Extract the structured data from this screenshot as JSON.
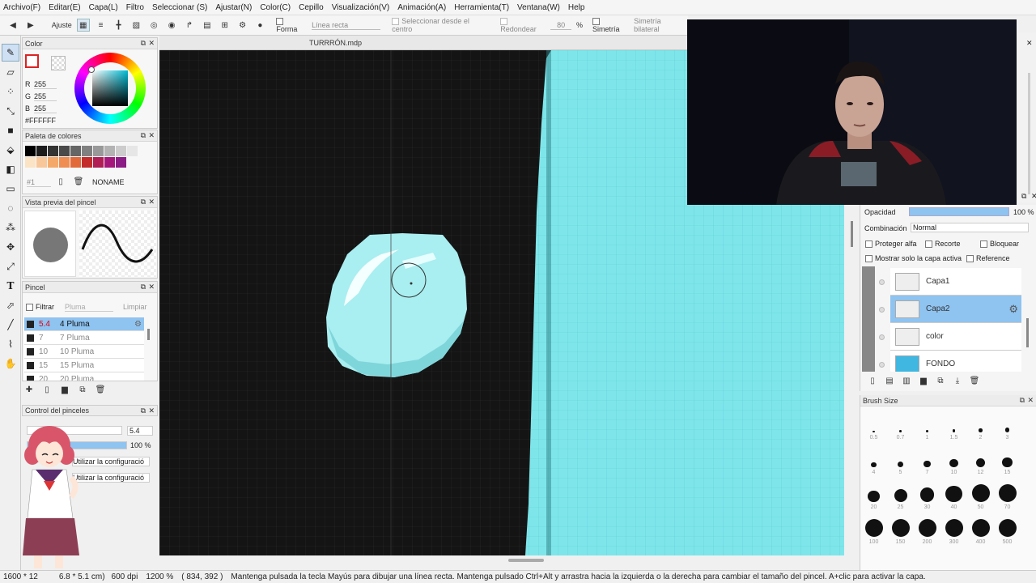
{
  "menu": [
    "Archivo(F)",
    "Editar(E)",
    "Capa(L)",
    "Filtro",
    "Seleccionar (S)",
    "Ajustar(N)",
    "Color(C)",
    "Cepillo",
    "Visualización(V)",
    "Animación(A)",
    "Herramienta(T)",
    "Ventana(W)",
    "Help"
  ],
  "toolbar": {
    "ajuste": "Ajuste",
    "forma_label": "Forma",
    "forma_value": "Línea recta",
    "select_center": "Seleccionar desde el centro",
    "redondear": "Redondear",
    "redondear_value": "80",
    "percent": "%",
    "simetria": "Simetría",
    "simetria_value": "Simetría bilateral"
  },
  "color_panel": {
    "title": "Color",
    "r_label": "R",
    "r": "255",
    "g_label": "G",
    "g": "255",
    "b_label": "B",
    "b": "255",
    "hex": "#FFFFFF",
    "main_color": "#ffffff",
    "sub_color": "#e0e0e0"
  },
  "palette_panel": {
    "title": "Paleta de colores",
    "row1": [
      "#000000",
      "#1c1c1c",
      "#333333",
      "#4a4a4a",
      "#666666",
      "#808080",
      "#999999",
      "#b3b3b3",
      "#cccccc",
      "#e6e6e6"
    ],
    "row2": [
      "#fbe3c5",
      "#f7c79a",
      "#f4a96a",
      "#ef8d52",
      "#e26a3a",
      "#c42b2b",
      "#b01e55",
      "#a6177b",
      "#8c1c86"
    ],
    "slot": "#1",
    "name": "NONAME"
  },
  "preview_panel": {
    "title": "Vista previa del pincel"
  },
  "brush_panel": {
    "title": "Pincel",
    "filter": "Filtrar",
    "filter_placeholder": "Pluma",
    "clear": "Limpiar",
    "items": [
      {
        "size": "5.4",
        "name": "4 Pluma",
        "selected": true
      },
      {
        "size": "7",
        "name": "7 Pluma",
        "selected": false
      },
      {
        "size": "10",
        "name": "10 Pluma",
        "selected": false
      },
      {
        "size": "15",
        "name": "15 Pluma",
        "selected": false
      },
      {
        "size": "20",
        "name": "20 Pluma",
        "selected": false
      }
    ]
  },
  "brush_control": {
    "title": "Control del pinceles",
    "size": "5.4",
    "opacity": "100 %",
    "opacity_fraction": 1.0,
    "pressure1": "Utilizar la configuració",
    "pressure2": "Utilizar la configuració"
  },
  "document": {
    "title": "TURRRÓN.mdp"
  },
  "layers": {
    "opacidad_label": "Opacidad",
    "opacidad_value": "100 %",
    "combinacion_label": "Combinación",
    "combinacion_value": "Normal",
    "proteger": "Proteger alfa",
    "recorte": "Recorte",
    "bloquear": "Bloquear",
    "solo_capa": "Mostrar solo la capa activa",
    "reference": "Reference",
    "items": [
      {
        "name": "Capa1",
        "selected": false
      },
      {
        "name": "Capa2",
        "selected": true
      },
      {
        "name": "color",
        "selected": false
      },
      {
        "name": "FONDO",
        "selected": false
      }
    ]
  },
  "brush_size": {
    "title": "Brush Size",
    "rows": [
      [
        "0.5",
        "0.7",
        "1",
        "1.5",
        "2",
        "3"
      ],
      [
        "4",
        "5",
        "7",
        "10",
        "12",
        "15"
      ],
      [
        "20",
        "25",
        "30",
        "40",
        "50",
        "70"
      ],
      [
        "100",
        "150",
        "200",
        "300",
        "400",
        "500"
      ]
    ]
  },
  "status": {
    "size": "1600 * 12",
    "cm": "6.8 * 5.1 cm)",
    "dpi": "600 dpi",
    "zoom": "1200 %",
    "coords": "( 834, 392 )",
    "hint": "Mantenga pulsada la tecla Mayús para dibujar una línea recta. Mantenga pulsado Ctrl+Alt y arrastra hacia la izquierda o la derecha para cambiar el tamaño del pincel. A+clic para activar la capa."
  },
  "colors": {
    "accent": "#8fc3f0",
    "cyan": "#7ee6ea",
    "canvas_dark": "#111111"
  }
}
